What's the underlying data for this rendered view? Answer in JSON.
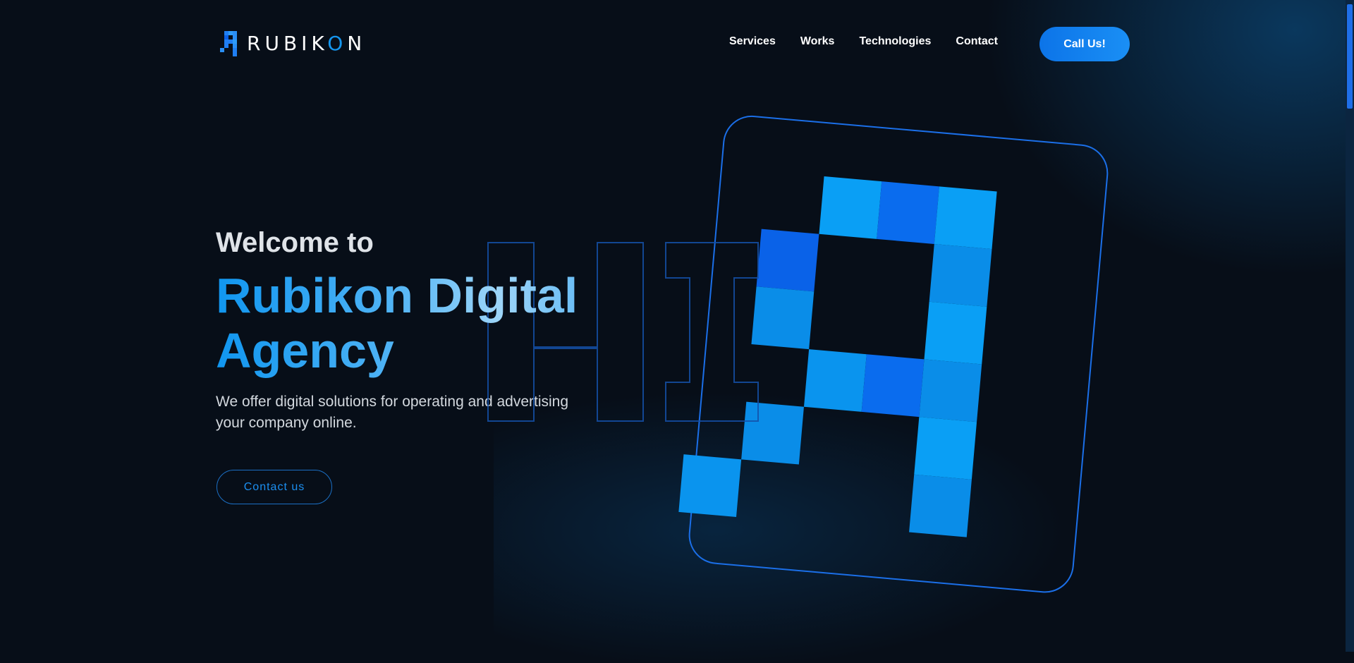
{
  "header": {
    "logo_text": "RUBIKON",
    "nav": [
      "Services",
      "Works",
      "Technologies",
      "Contact"
    ],
    "cta_label": "Call Us!"
  },
  "hero": {
    "welcome": "Welcome to",
    "title_line1": "Rubikon Digital",
    "title_line2": "Agency",
    "subtitle_line1": "We offer digital solutions for operating and advertising",
    "subtitle_line2": "your company online.",
    "contact_label": "Contact us",
    "outline_text": "HI"
  },
  "colors": {
    "background": "#070e18",
    "accent": "#1c8ff0",
    "accent_dark": "#0a62e8",
    "frame_stroke": "#1b6fe8"
  },
  "icons": {
    "logo": "rubikon-pixel-logo-icon",
    "illustration": "pixel-letter-R-icon"
  }
}
